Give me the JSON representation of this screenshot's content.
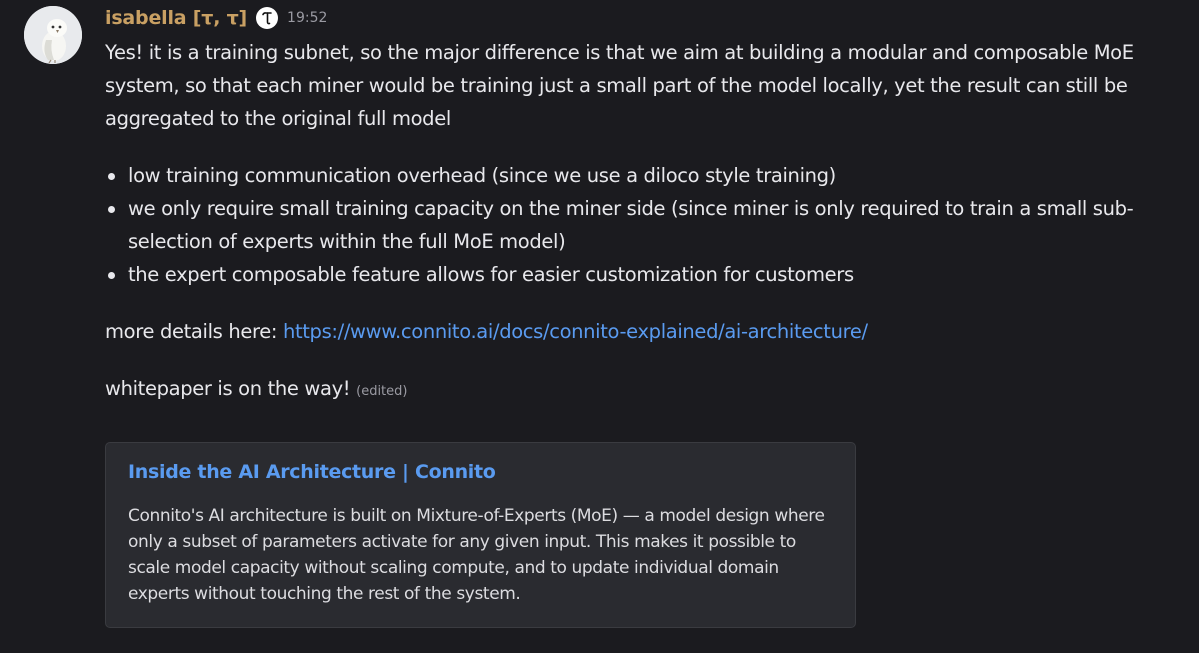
{
  "message": {
    "username": "isabella [τ, τ]",
    "badge_icon": "tao-symbol-icon",
    "badge_glyph": "τ",
    "timestamp": "19:52",
    "avatar_icon": "owl-avatar",
    "intro": "Yes! it is a training subnet, so the major difference is that we aim at building a modular and composable MoE system, so that each miner would be training just a small part of the model locally, yet the result can still be aggregated to the original full model",
    "bullets": [
      "low training communication overhead (since we use a diloco style training)",
      "we only require small training capacity on the miner side (since miner is only required to train a small sub-selection of experts within the full MoE model)",
      "the expert composable feature allows for easier customization for customers"
    ],
    "details_prefix": "more details here: ",
    "details_link": "https://www.connito.ai/docs/connito-explained/ai-architecture/",
    "whitepaper_text": "whitepaper is on the way!",
    "edited_label": "(edited)"
  },
  "embed": {
    "title": "Inside the AI Architecture | Connito",
    "description": "Connito's AI architecture is built on Mixture-of-Experts (MoE) — a model design where only a subset of parameters activate for any given input. This makes it possible to scale model capacity without scaling compute, and to update individual domain experts without touching the rest of the system."
  },
  "colors": {
    "background": "#1b1b1f",
    "username": "#c9a063",
    "link": "#5a9bf0",
    "embed_background": "#2a2b30"
  }
}
